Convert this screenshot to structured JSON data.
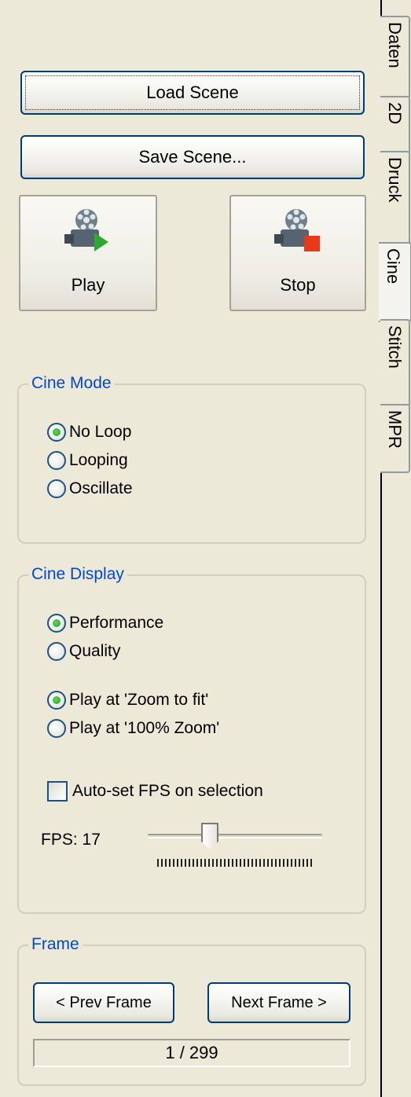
{
  "scene": {
    "load_label": "Load Scene",
    "save_label": "Save Scene..."
  },
  "playback": {
    "play_label": "Play",
    "stop_label": "Stop"
  },
  "cine_mode": {
    "title": "Cine Mode",
    "options": [
      "No Loop",
      "Looping",
      "Oscillate"
    ],
    "selected": "No Loop"
  },
  "cine_display": {
    "title": "Cine Display",
    "render_options": [
      "Performance",
      "Quality"
    ],
    "render_selected": "Performance",
    "zoom_options": [
      "Play at 'Zoom to fit'",
      "Play at '100% Zoom'"
    ],
    "zoom_selected": "Play at 'Zoom to fit'",
    "auto_fps_label": "Auto-set FPS on selection",
    "auto_fps_checked": false,
    "fps_label": "FPS: 17",
    "fps_value": 17
  },
  "frame": {
    "title": "Frame",
    "prev_label": "< Prev Frame",
    "next_label": "Next Frame >",
    "position": "1 / 299"
  },
  "tabs": [
    {
      "label": "Daten"
    },
    {
      "label": "2D"
    },
    {
      "label": "Druck"
    },
    {
      "label": "Cine"
    },
    {
      "label": "Stitch"
    },
    {
      "label": "MPR"
    }
  ],
  "active_tab": "Cine",
  "colors": {
    "background": "#ece9d8",
    "group_title": "#0046d5",
    "button_border": "#003c74"
  },
  "icons": {
    "play": "film-reel-play-icon",
    "stop": "film-reel-stop-icon"
  }
}
